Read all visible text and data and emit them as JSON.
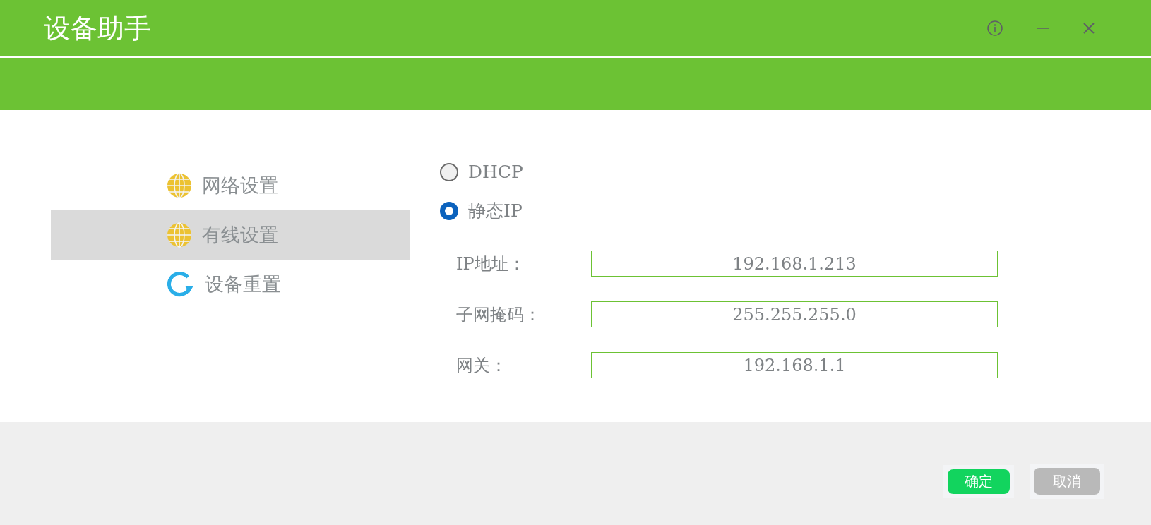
{
  "window": {
    "title": "设备助手"
  },
  "sidebar": {
    "items": [
      {
        "label": "网络设置",
        "kind": "globe",
        "selected": false
      },
      {
        "label": "有线设置",
        "kind": "globe",
        "selected": true
      },
      {
        "label": "设备重置",
        "kind": "reset",
        "selected": false
      }
    ]
  },
  "mode_options": [
    {
      "label": "DHCP",
      "selected": false
    },
    {
      "label": "静态IP",
      "selected": true
    }
  ],
  "fields": [
    {
      "label": "IP地址：",
      "value": "192.168.1.213"
    },
    {
      "label": "子网掩码：",
      "value": "255.255.255.0"
    },
    {
      "label": "网关：",
      "value": "192.168.1.1"
    }
  ],
  "buttons": [
    {
      "label": "确定",
      "disabled": false
    },
    {
      "label": "取消",
      "disabled": true
    }
  ]
}
